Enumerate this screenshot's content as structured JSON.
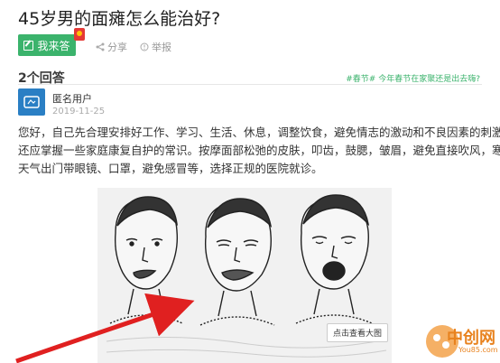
{
  "question": {
    "title": "45岁男的面瘫怎么能治好?"
  },
  "toolbar": {
    "answer_label": "我来答",
    "share_label": "分享",
    "report_label": "举报"
  },
  "answers": {
    "count_label": "2个回答",
    "tag_prefix": "#春节#",
    "tag_link": "今年春节在家聚还是出去嗨?"
  },
  "answer": {
    "user": "匿名用户",
    "date": "2019-11-25",
    "paragraph": [
      "您好，自己先合理安排好工作、学习、生活、休息，调整饮食，避免情志的激动和不良因素的刺激。",
      "还应掌握一些家庭康复自护的常识。按摩面部松弛的皮肤，叩齿，鼓腮，皱眉，避免直接吹风，寒冷",
      "天气出门带眼镜、口罩，避免感冒等，选择正规的医院就诊。"
    ],
    "view_large_label": "点击查看大图"
  },
  "watermark": {
    "text": "中创网",
    "sub": "You85.com"
  },
  "colors": {
    "accent": "#3bb36c",
    "arrow": "#e02020",
    "avatar": "#2a7fc4"
  }
}
